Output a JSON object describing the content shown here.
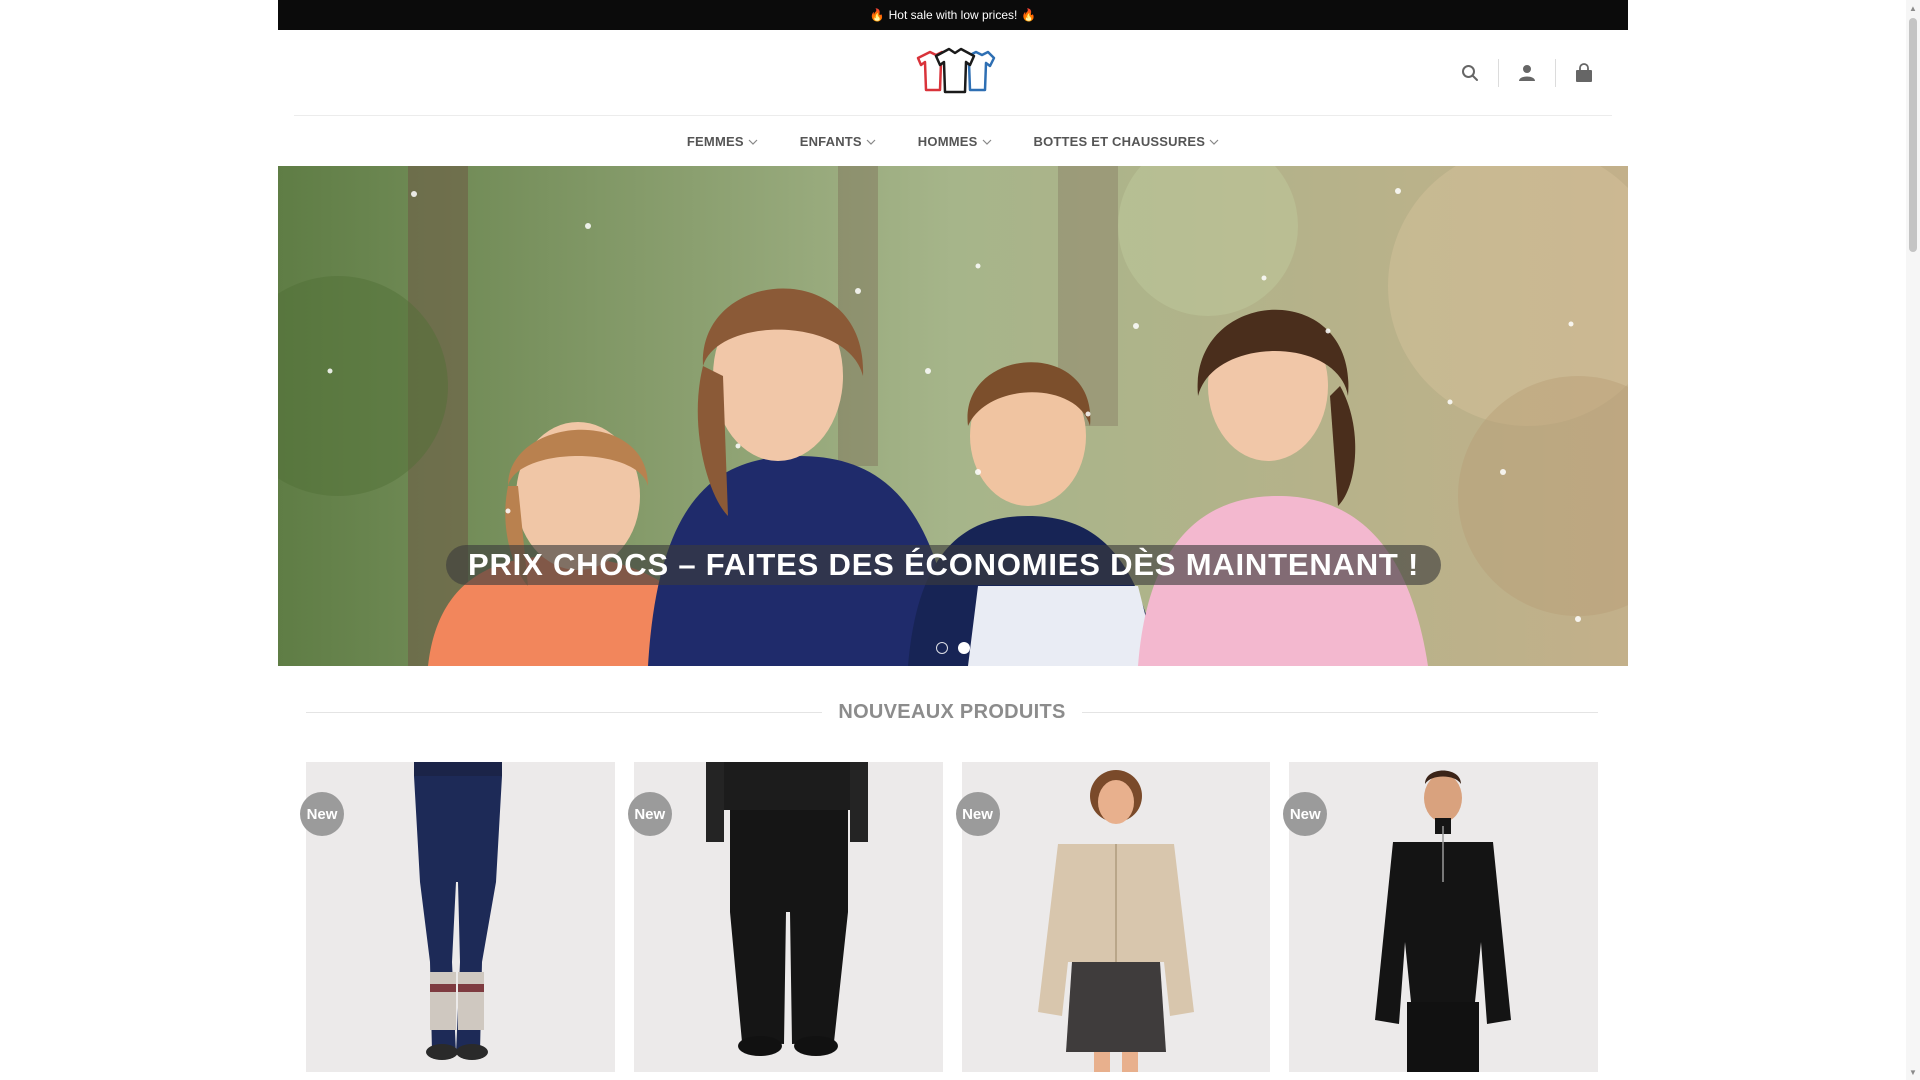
{
  "announcement": {
    "text": "Hot sale with low prices!",
    "icon": "flame-icon"
  },
  "header": {
    "logo": "t-shirts-logo",
    "icons": [
      "search-icon",
      "user-icon",
      "shopping-bag-icon"
    ]
  },
  "nav": {
    "items": [
      {
        "label": "FEMMES"
      },
      {
        "label": "ENFANTS"
      },
      {
        "label": "HOMMES"
      },
      {
        "label": "BOTTES ET CHAUSSURES"
      }
    ]
  },
  "hero": {
    "caption": "PRIX CHOCS – FAITES DES ÉCONOMIES DÈS MAINTENANT !",
    "slides": 2,
    "active_slide": 2
  },
  "section": {
    "title": "NOUVEAUX PRODUITS"
  },
  "products": [
    {
      "badge": "New"
    },
    {
      "badge": "New"
    },
    {
      "badge": "New"
    },
    {
      "badge": "New"
    }
  ],
  "colors": {
    "topbar_bg": "#0b0b0b",
    "nav_text": "#555555",
    "badge_bg": "#9b9b9b",
    "card_bg": "#eceaea"
  }
}
